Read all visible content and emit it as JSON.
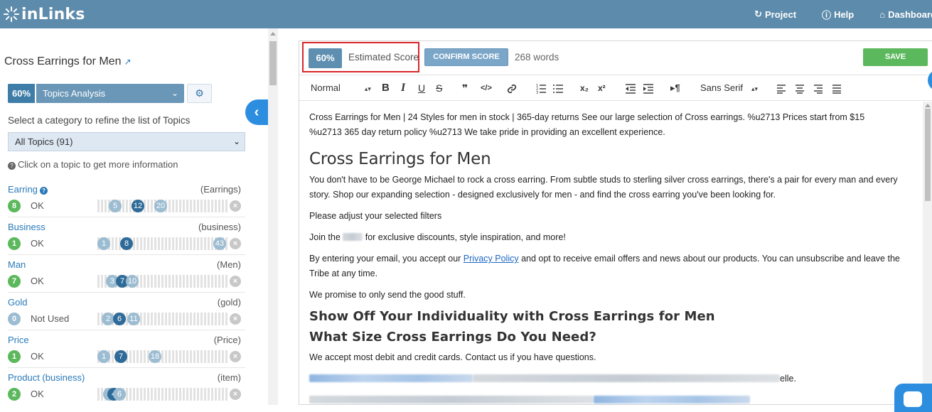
{
  "nav": {
    "logo_text": "inLinks",
    "links": [
      {
        "icon": "refresh-icon",
        "label": "Project"
      },
      {
        "icon": "question-circle-icon",
        "label": "Help"
      },
      {
        "icon": "home-icon",
        "label": "Dashboard"
      }
    ]
  },
  "sidebar": {
    "keyword": "Cross Earrings for Men",
    "score": "60%",
    "analysis_option": "Topics Analysis",
    "category_prompt": "Select a category to refine the list of Topics",
    "category_selected": "All Topics (91)",
    "hint": "Click on a topic to get more information",
    "topics": [
      {
        "name": "Earring",
        "type": "(Earrings)",
        "count": "8",
        "status": "OK",
        "dots": [
          {
            "v": "5",
            "s": "light"
          },
          {
            "v": "12",
            "s": "dark"
          },
          {
            "v": "20",
            "s": "light"
          }
        ]
      },
      {
        "name": "Business",
        "type": "(business)",
        "count": "1",
        "status": "OK",
        "dots": [
          {
            "v": "1",
            "s": "light"
          },
          {
            "v": "8",
            "s": "dark"
          },
          {
            "v": "43",
            "s": "light"
          }
        ]
      },
      {
        "name": "Man",
        "type": "(Men)",
        "count": "7",
        "status": "OK",
        "dots": [
          {
            "v": "3",
            "s": "light"
          },
          {
            "v": "7",
            "s": "dark"
          },
          {
            "v": "10",
            "s": "light"
          }
        ]
      },
      {
        "name": "Gold",
        "type": "(gold)",
        "count": "0",
        "status": "Not Used",
        "dots": [
          {
            "v": "2",
            "s": "light"
          },
          {
            "v": "6",
            "s": "dark"
          },
          {
            "v": "11",
            "s": "light"
          }
        ]
      },
      {
        "name": "Price",
        "type": "(Price)",
        "count": "1",
        "status": "OK",
        "dots": [
          {
            "v": "1",
            "s": "light"
          },
          {
            "v": "7",
            "s": "dark"
          },
          {
            "v": "18",
            "s": "light"
          }
        ]
      },
      {
        "name": "Product (business)",
        "type": "(item)",
        "count": "2",
        "status": "OK",
        "dots": [
          {
            "v": "3",
            "s": "light"
          },
          {
            "v": "4",
            "s": "dark"
          },
          {
            "v": "6",
            "s": "light"
          }
        ]
      }
    ]
  },
  "editor": {
    "score": "60%",
    "score_label": "Estimated Score",
    "confirm_label": "CONFIRM SCORE",
    "word_count": "268 words",
    "save_label": "SAVE",
    "toolbar": {
      "heading_select": "Normal",
      "font_select": "Sans Serif",
      "bold": "B",
      "italic": "I",
      "underline": "U",
      "strike": "S",
      "blockquote": "99",
      "code": "</>"
    },
    "content": {
      "meta_line_1": "Cross Earrings for Men | 24 Styles for men in stock | 365-day returns See our large selection of Cross earrings. %u2713 Prices start from $15",
      "meta_line_2": "%u2713 365 day return policy %u2713 We take pride in providing an excellent experience.",
      "h1": "Cross Earrings for Men",
      "p1": "You don't have to be George Michael to rock a cross earring. From subtle studs to sterling silver cross earrings, there's a pair for every man and every story. Shop our expanding selection - designed exclusively for men - and find the cross earring you've been looking for.",
      "p2": "Please adjust your selected filters",
      "p3_before": "Join the",
      "p3_after": "for exclusive discounts, style inspiration, and more!",
      "p4_before": "By entering your email, you accept our",
      "p4_link": "Privacy Policy",
      "p4_after": "and opt to receive email offers and news about our products. You can unsubscribe and leave the Tribe at any time.",
      "p5": "We promise to only send the good stuff.",
      "h2a": "Show Off Your Individuality with Cross Earrings for Men",
      "h2b": "What Size Cross Earrings Do You Need?",
      "p6": "We accept most debit and credit cards. Contact us if you have questions.",
      "p7_after": "elle."
    }
  },
  "colors": {
    "topbar": "#5d8bab",
    "score_pill": "#3d7da7",
    "save_green": "#5cb85c",
    "highlight_red": "#d9262b",
    "link_blue": "#2a7ab8"
  }
}
